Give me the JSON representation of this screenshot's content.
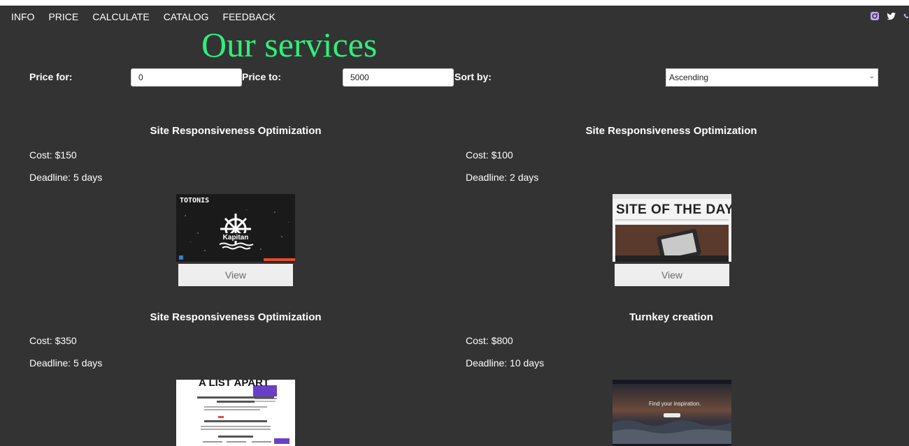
{
  "nav": [
    "INFO",
    "PRICE",
    "CALCULATE",
    "CATALOG",
    "FEEDBACK"
  ],
  "socials": [
    "instagram-icon",
    "twitter-icon",
    "phone-icon"
  ],
  "heading": "Our services",
  "filters": {
    "price_from_label": "Price for:",
    "price_from_value": "0",
    "price_to_label": "Price to:",
    "price_to_value": "5000",
    "sort_label": "Sort by:",
    "sort_value": "Ascending"
  },
  "view_label": "View",
  "cards": [
    {
      "title": "Site Responsiveness Optimization",
      "cost": "Cost: $150",
      "deadline": "Deadline: 5 days",
      "thumb": "TOTONIS",
      "thumb_logo": "Kapitan"
    },
    {
      "title": "Site Responsiveness Optimization",
      "cost": "Cost: $100",
      "deadline": "Deadline: 2 days",
      "thumb": "SITE OF THE DAY"
    },
    {
      "title": "Site Responsiveness Optimization",
      "cost": "Cost: $350",
      "deadline": "Deadline: 5 days",
      "thumb": "A LIST APART"
    },
    {
      "title": "Turnkey creation",
      "cost": "Cost: $800",
      "deadline": "Deadline: 10 days",
      "thumb": "Find your inspiration."
    }
  ],
  "colors": {
    "background": "#333333",
    "heading": "#2ef07a",
    "button": "#eeeeee"
  }
}
